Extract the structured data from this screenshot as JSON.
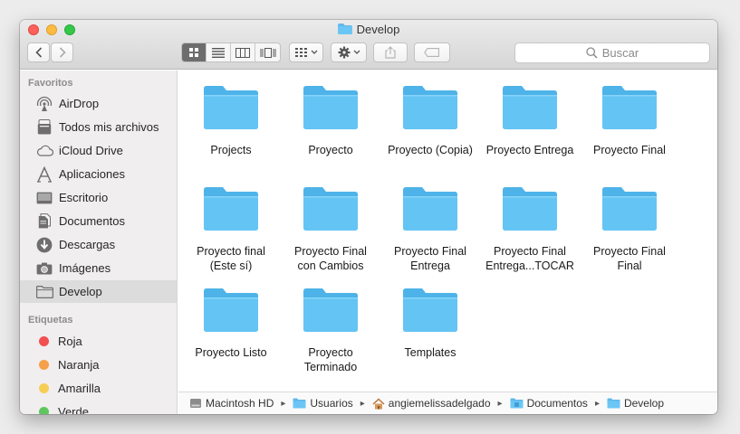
{
  "window": {
    "title": "Develop"
  },
  "toolbar": {
    "back_label": "‹",
    "forward_label": "›",
    "search_placeholder": "Buscar"
  },
  "sidebar": {
    "favorites_header": "Favoritos",
    "favorites": [
      {
        "label": "AirDrop",
        "icon": "airdrop-icon"
      },
      {
        "label": "Todos mis archivos",
        "icon": "all-files-icon"
      },
      {
        "label": "iCloud Drive",
        "icon": "cloud-icon"
      },
      {
        "label": "Aplicaciones",
        "icon": "applications-icon"
      },
      {
        "label": "Escritorio",
        "icon": "desktop-icon"
      },
      {
        "label": "Documentos",
        "icon": "documents-icon"
      },
      {
        "label": "Descargas",
        "icon": "downloads-icon"
      },
      {
        "label": "Imágenes",
        "icon": "camera-icon"
      },
      {
        "label": "Develop",
        "icon": "folder-icon",
        "selected": true
      }
    ],
    "tags_header": "Etiquetas",
    "tags": [
      {
        "label": "Roja",
        "color": "#f0504f"
      },
      {
        "label": "Naranja",
        "color": "#f5a04a"
      },
      {
        "label": "Amarilla",
        "color": "#f7ce55"
      },
      {
        "label": "Verde",
        "color": "#5fc65e"
      }
    ]
  },
  "folders": [
    {
      "line1": "Projects",
      "line2": ""
    },
    {
      "line1": "Proyecto",
      "line2": ""
    },
    {
      "line1": "Proyecto (Copia)",
      "line2": ""
    },
    {
      "line1": "Proyecto Entrega",
      "line2": ""
    },
    {
      "line1": "Proyecto Final",
      "line2": ""
    },
    {
      "line1": "Proyecto final",
      "line2": "(Este sí)"
    },
    {
      "line1": "Proyecto Final",
      "line2": "con Cambios"
    },
    {
      "line1": "Proyecto Final",
      "line2": "Entrega"
    },
    {
      "line1": "Proyecto Final",
      "line2": "Entrega...TOCAR"
    },
    {
      "line1": "Proyecto Final",
      "line2": "Final"
    },
    {
      "line1": "Proyecto Listo",
      "line2": ""
    },
    {
      "line1": "Proyecto",
      "line2": "Terminado"
    },
    {
      "line1": "Templates",
      "line2": ""
    }
  ],
  "pathbar": [
    {
      "label": "Macintosh HD",
      "icon": "hard-drive-icon"
    },
    {
      "label": "Usuarios",
      "icon": "folder-icon"
    },
    {
      "label": "angiemelissadelgado",
      "icon": "home-icon"
    },
    {
      "label": "Documentos",
      "icon": "documents-folder-icon"
    },
    {
      "label": "Develop",
      "icon": "folder-icon"
    }
  ],
  "colors": {
    "folder_blue": "#5fc3f3",
    "folder_blue_tab": "#4eb3e8",
    "selection_gray": "#dcdcdc"
  }
}
